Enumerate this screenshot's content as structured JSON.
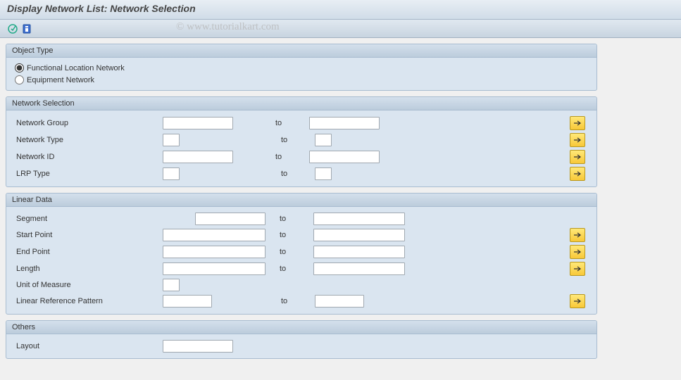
{
  "title": "Display Network List: Network Selection",
  "watermark": "© www.tutorialkart.com",
  "common": {
    "to": "to"
  },
  "groups": {
    "object_type": {
      "header": "Object Type",
      "opt_floc": "Functional Location Network",
      "opt_equip": "Equipment Network"
    },
    "network_selection": {
      "header": "Network Selection",
      "network_group": "Network Group",
      "network_type": "Network Type",
      "network_id": "Network ID",
      "lrp_type": "LRP Type"
    },
    "linear_data": {
      "header": "Linear Data",
      "segment": "Segment",
      "start_point": "Start Point",
      "end_point": "End Point",
      "length": "Length",
      "uom": "Unit of Measure",
      "lrp_pattern": "Linear Reference Pattern"
    },
    "others": {
      "header": "Others",
      "layout": "Layout"
    }
  }
}
